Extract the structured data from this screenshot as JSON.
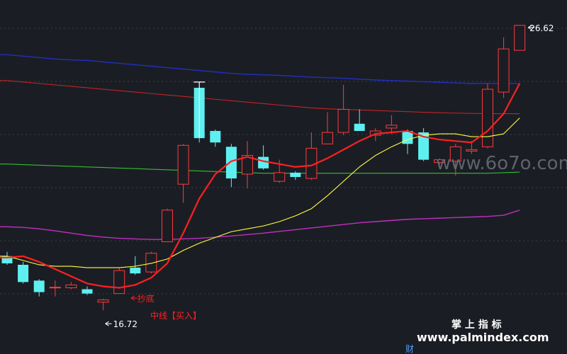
{
  "chart_data": {
    "type": "candlestick",
    "ylim": [
      15.2,
      27.5
    ],
    "grid": true,
    "colors": {
      "up": "#ff3b3b",
      "down": "#5ef0f0",
      "mid_line": "#ff2020",
      "ma_yellow": "#ffff40",
      "band_blue": "#2030c0",
      "band_red": "#c02424",
      "band_green": "#30c030",
      "band_magenta": "#c030c0",
      "signal_text": "#ff2020",
      "marker": "#ffffff"
    },
    "candles": [
      {
        "o": 18.6,
        "c": 18.35,
        "h": 18.75,
        "l": 18.3
      },
      {
        "o": 18.3,
        "c": 17.7,
        "h": 18.4,
        "l": 17.65
      },
      {
        "o": 17.75,
        "c": 17.35,
        "h": 17.8,
        "l": 17.2
      },
      {
        "o": 17.52,
        "c": 17.52,
        "h": 17.75,
        "l": 17.2
      },
      {
        "o": 17.5,
        "c": 17.6,
        "h": 17.7,
        "l": 17.45
      },
      {
        "o": 17.45,
        "c": 17.3,
        "h": 17.55,
        "l": 17.25
      },
      {
        "o": 17.0,
        "c": 17.08,
        "h": 17.12,
        "l": 16.72
      },
      {
        "o": 17.3,
        "c": 18.1,
        "h": 18.2,
        "l": 17.3
      },
      {
        "o": 18.2,
        "c": 18.0,
        "h": 18.6,
        "l": 17.95
      },
      {
        "o": 18.05,
        "c": 18.7,
        "h": 18.75,
        "l": 18.0
      },
      {
        "o": 19.1,
        "c": 20.2,
        "h": 20.25,
        "l": 19.1
      },
      {
        "o": 21.1,
        "c": 22.45,
        "h": 22.5,
        "l": 20.45
      },
      {
        "o": 24.45,
        "c": 22.7,
        "h": 24.65,
        "l": 22.55
      },
      {
        "o": 22.95,
        "c": 22.55,
        "h": 23.0,
        "l": 22.4
      },
      {
        "o": 22.4,
        "c": 21.3,
        "h": 22.5,
        "l": 21.0
      },
      {
        "o": 21.45,
        "c": 22.1,
        "h": 22.6,
        "l": 20.95
      },
      {
        "o": 22.05,
        "c": 21.65,
        "h": 22.45,
        "l": 21.6
      },
      {
        "o": 21.2,
        "c": 21.5,
        "h": 21.95,
        "l": 21.15
      },
      {
        "o": 21.5,
        "c": 21.35,
        "h": 21.55,
        "l": 21.25
      },
      {
        "o": 21.3,
        "c": 22.35,
        "h": 22.9,
        "l": 21.25
      },
      {
        "o": 22.5,
        "c": 22.9,
        "h": 23.6,
        "l": 22.5
      },
      {
        "o": 22.9,
        "c": 23.7,
        "h": 24.55,
        "l": 22.8
      },
      {
        "o": 23.2,
        "c": 22.95,
        "h": 23.7,
        "l": 22.95
      },
      {
        "o": 22.8,
        "c": 22.95,
        "h": 23.05,
        "l": 22.6
      },
      {
        "o": 23.05,
        "c": 23.15,
        "h": 23.5,
        "l": 22.85
      },
      {
        "o": 22.95,
        "c": 22.5,
        "h": 23.0,
        "l": 22.15
      },
      {
        "o": 22.9,
        "c": 21.95,
        "h": 23.05,
        "l": 21.9
      },
      {
        "o": 21.85,
        "c": 21.95,
        "h": 22.0,
        "l": 21.8
      },
      {
        "o": 21.9,
        "c": 22.4,
        "h": 22.5,
        "l": 21.4
      },
      {
        "o": 22.25,
        "c": 22.3,
        "h": 22.6,
        "l": 22.15
      },
      {
        "o": 22.4,
        "c": 24.4,
        "h": 24.6,
        "l": 22.35
      },
      {
        "o": 24.3,
        "c": 25.8,
        "h": 26.2,
        "l": 24.1
      },
      {
        "o": 25.75,
        "c": 26.62,
        "h": 26.62,
        "l": 25.75
      }
    ],
    "mid_line": [
      18.55,
      18.6,
      18.4,
      18.15,
      17.9,
      17.65,
      17.55,
      17.5,
      17.6,
      17.85,
      18.35,
      19.4,
      20.6,
      21.45,
      21.9,
      22.05,
      21.9,
      21.8,
      21.7,
      21.75,
      22.0,
      22.3,
      22.6,
      22.85,
      22.9,
      22.95,
      22.75,
      22.65,
      22.6,
      22.55,
      22.95,
      23.55,
      24.6
    ],
    "ma_yellow": [
      18.6,
      18.45,
      18.3,
      18.25,
      18.25,
      18.2,
      18.2,
      18.2,
      18.25,
      18.35,
      18.5,
      18.8,
      19.05,
      19.25,
      19.45,
      19.55,
      19.65,
      19.8,
      20.0,
      20.25,
      20.7,
      21.2,
      21.7,
      22.1,
      22.4,
      22.65,
      22.8,
      22.85,
      22.85,
      22.75,
      22.75,
      22.85,
      23.4
    ],
    "band_blue": [
      25.6,
      25.55,
      25.5,
      25.45,
      25.42,
      25.4,
      25.35,
      25.3,
      25.25,
      25.2,
      25.15,
      25.1,
      25.05,
      25.0,
      24.95,
      24.92,
      24.9,
      24.88,
      24.85,
      24.82,
      24.8,
      24.78,
      24.75,
      24.72,
      24.7,
      24.68,
      24.66,
      24.64,
      24.62,
      24.6,
      24.6,
      24.6,
      24.6
    ],
    "band_red": [
      24.7,
      24.65,
      24.6,
      24.55,
      24.5,
      24.45,
      24.4,
      24.35,
      24.3,
      24.25,
      24.2,
      24.15,
      24.1,
      24.05,
      24.0,
      23.95,
      23.9,
      23.85,
      23.8,
      23.75,
      23.72,
      23.7,
      23.68,
      23.66,
      23.64,
      23.62,
      23.6,
      23.58,
      23.57,
      23.56,
      23.55,
      23.55,
      23.55
    ],
    "band_green": [
      21.8,
      21.78,
      21.76,
      21.74,
      21.72,
      21.7,
      21.68,
      21.66,
      21.64,
      21.62,
      21.6,
      21.58,
      21.56,
      21.54,
      21.52,
      21.5,
      21.48,
      21.48,
      21.48,
      21.48,
      21.48,
      21.48,
      21.48,
      21.48,
      21.48,
      21.48,
      21.48,
      21.48,
      21.48,
      21.48,
      21.48,
      21.5,
      21.52
    ],
    "band_magenta": [
      19.62,
      19.6,
      19.55,
      19.48,
      19.4,
      19.32,
      19.26,
      19.22,
      19.2,
      19.18,
      19.18,
      19.2,
      19.22,
      19.26,
      19.3,
      19.35,
      19.4,
      19.46,
      19.52,
      19.58,
      19.64,
      19.7,
      19.76,
      19.8,
      19.84,
      19.88,
      19.9,
      19.92,
      19.94,
      19.96,
      19.98,
      20.02,
      20.2
    ],
    "annotations": {
      "high_label": "26.62",
      "low_label": "16.72",
      "signal_label": "抄底",
      "midline_label": "中线【买入】"
    }
  },
  "watermarks": {
    "top": "www.6o7o.com",
    "brand_cn": "掌 上 指 标",
    "brand_url": "www.palmindex.com",
    "footer_char": "财"
  }
}
